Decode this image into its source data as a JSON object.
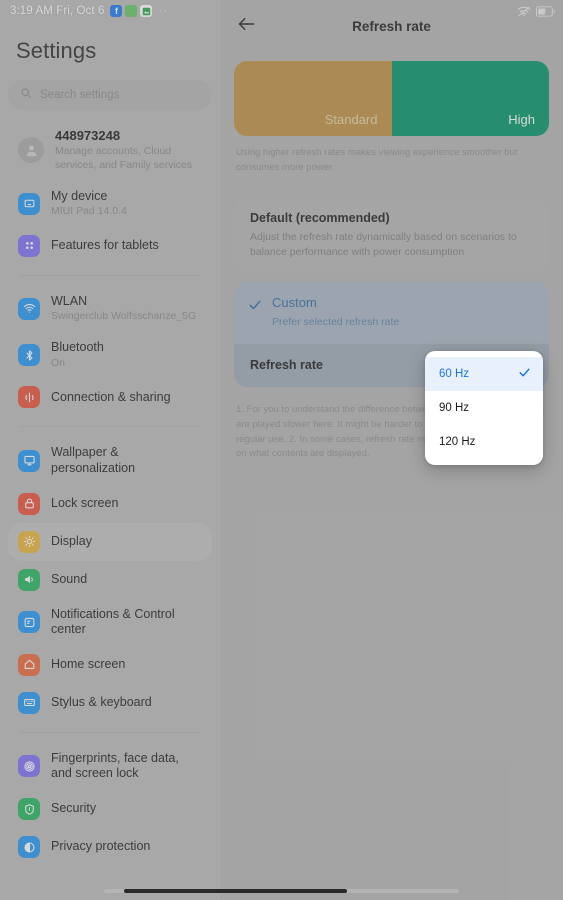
{
  "status_bar": {
    "time": "3:19 AM Fri, Oct 6",
    "app_icons": [
      {
        "name": "facebook-icon",
        "glyph": "f"
      },
      {
        "name": "app-icon-green",
        "glyph": ""
      },
      {
        "name": "photos-icon",
        "glyph": ""
      }
    ],
    "overflow": "··",
    "wifi_icon": "wifi-off-icon",
    "battery_icon": "battery-icon"
  },
  "sidebar": {
    "title": "Settings",
    "search": {
      "placeholder": "Search settings",
      "icon": "search-icon"
    },
    "groups": [
      {
        "items": [
          {
            "name": "account",
            "label": "448973248",
            "sub": "Manage accounts, Cloud services, and Family services",
            "icon": "user-avatar-icon",
            "icon_color": "#a8a8a8"
          },
          {
            "name": "my-device",
            "label": "My device",
            "sub": "MIUI Pad 14.0.4",
            "icon": "tablet-icon",
            "icon_color": "#2196f3"
          },
          {
            "name": "features-for-tablets",
            "label": "Features for tablets",
            "sub": "",
            "icon": "grid-dots-icon",
            "icon_color": "#7c6df2"
          }
        ]
      },
      {
        "items": [
          {
            "name": "wlan",
            "label": "WLAN",
            "sub": "Swingerclub Wolfsschanze_5G",
            "icon": "wifi-icon",
            "icon_color": "#2196f3"
          },
          {
            "name": "bluetooth",
            "label": "Bluetooth",
            "sub": "On",
            "icon": "bluetooth-icon",
            "icon_color": "#2196f3"
          },
          {
            "name": "connection-and-sharing",
            "label": "Connection & sharing",
            "sub": "",
            "icon": "connection-share-icon",
            "icon_color": "#e8503a"
          }
        ]
      },
      {
        "items": [
          {
            "name": "wallpaper-and-personalization",
            "label": "Wallpaper & personalization",
            "sub": "",
            "icon": "wallpaper-icon",
            "icon_color": "#2196f3"
          },
          {
            "name": "lock-screen",
            "label": "Lock screen",
            "sub": "",
            "icon": "lock-icon",
            "icon_color": "#e8503a"
          },
          {
            "name": "display",
            "label": "Display",
            "sub": "",
            "icon": "brightness-sun-icon",
            "icon_color": "#e8b339",
            "selected": true
          },
          {
            "name": "sound",
            "label": "Sound",
            "sub": "",
            "icon": "speaker-icon",
            "icon_color": "#22b35e"
          },
          {
            "name": "notifications-and-control-center",
            "label": "Notifications & Control center",
            "sub": "",
            "icon": "notification-icon",
            "icon_color": "#2196f3"
          },
          {
            "name": "home-screen",
            "label": "Home screen",
            "sub": "",
            "icon": "home-icon",
            "icon_color": "#e8673a"
          },
          {
            "name": "stylus-and-keyboard",
            "label": "Stylus & keyboard",
            "sub": "",
            "icon": "keyboard-icon",
            "icon_color": "#2196f3"
          }
        ]
      },
      {
        "items": [
          {
            "name": "fingerprints-face-data-and-screen-lock",
            "label": "Fingerprints, face data, and screen lock",
            "sub": "",
            "icon": "fingerprint-icon",
            "icon_color": "#7c6df2"
          },
          {
            "name": "security",
            "label": "Security",
            "sub": "",
            "icon": "shield-icon",
            "icon_color": "#22b35e"
          },
          {
            "name": "privacy-protection",
            "label": "Privacy protection",
            "sub": "",
            "icon": "privacy-icon",
            "icon_color": "#2196f3"
          }
        ]
      }
    ]
  },
  "main": {
    "back_icon": "back-arrow-icon",
    "title": "Refresh rate",
    "banner": {
      "standard_label": "Standard",
      "high_label": "High",
      "standard_color": "#bd9040",
      "high_color": "#009267"
    },
    "banner_note": "Using higher refresh rates makes viewing experience smoother but consumes more power.",
    "options": [
      {
        "name": "default-recommended",
        "title": "Default (recommended)",
        "desc": "Adjust the refresh rate dynamically based on scenarios to balance performance with power consumption",
        "selected": false
      },
      {
        "name": "custom",
        "title": "Custom",
        "desc": "Prefer selected refresh rate",
        "selected": true,
        "check_icon": "check-icon"
      }
    ],
    "rate_row": {
      "label": "Refresh rate",
      "value": "60 Hz",
      "icon": "stepper-updown-icon"
    },
    "footnote": "1. For you to understand the difference between the refresh rates, demos are played slower here. It might be harder to notice the difference during regular use.\n2. In some cases, refresh rate might be adjusted depending on what contents are displayed."
  },
  "dropdown": {
    "name": "refresh-rate-dropdown",
    "items": [
      {
        "label": "60 Hz",
        "selected": true
      },
      {
        "label": "90 Hz",
        "selected": false
      },
      {
        "label": "120 Hz",
        "selected": false
      }
    ],
    "check_icon": "check-icon"
  },
  "gesture_bar": {
    "name": "gesture-navigation-bar"
  }
}
